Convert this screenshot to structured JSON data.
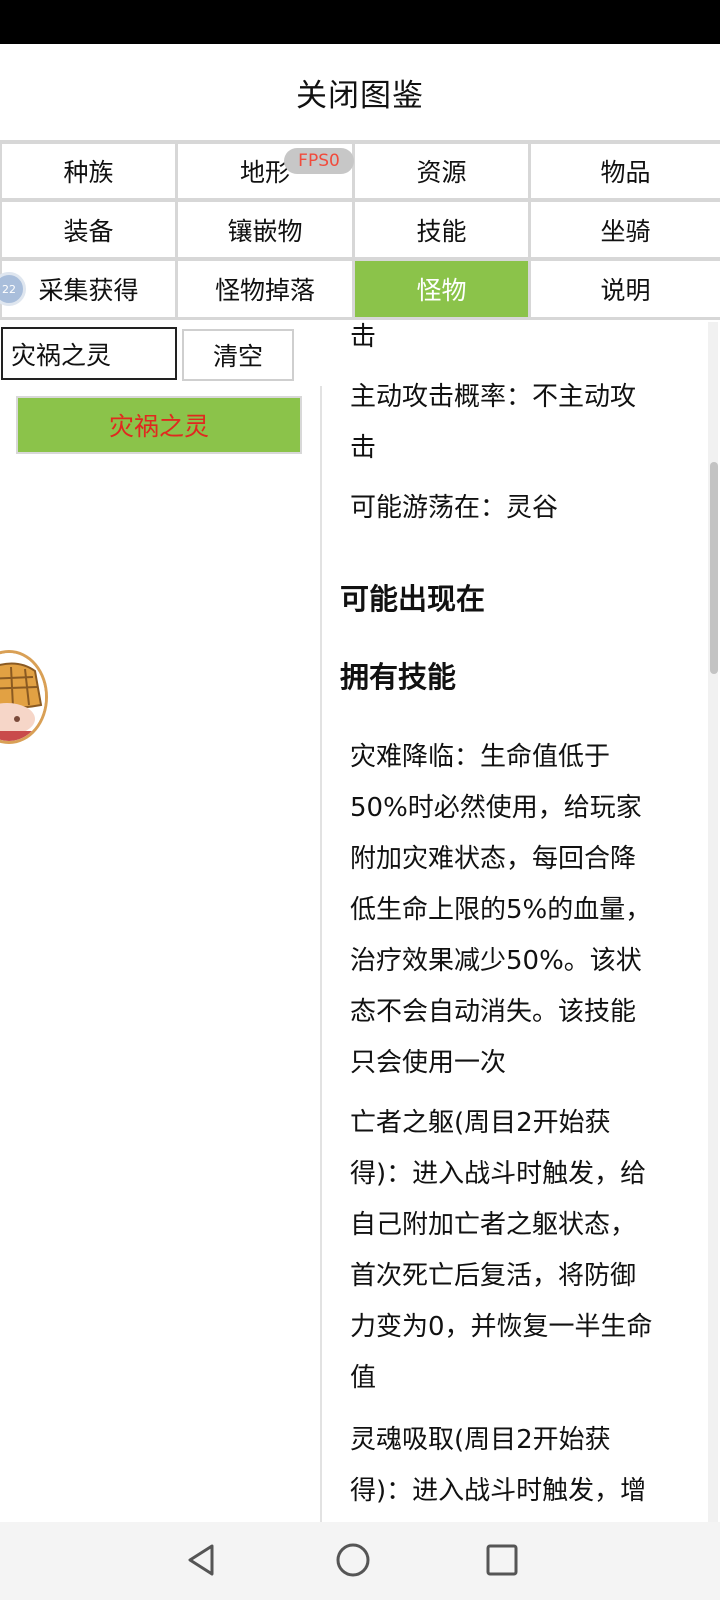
{
  "header": {
    "title": "关闭图鉴"
  },
  "fps_badge": "FPS0",
  "tiny_avatar_text": "22",
  "tabs": [
    {
      "label": "种族"
    },
    {
      "label": "地形"
    },
    {
      "label": "资源"
    },
    {
      "label": "物品"
    },
    {
      "label": "装备"
    },
    {
      "label": "镶嵌物"
    },
    {
      "label": "技能"
    },
    {
      "label": "坐骑"
    },
    {
      "label": "采集获得"
    },
    {
      "label": "怪物掉落"
    },
    {
      "label": "怪物",
      "active": true
    },
    {
      "label": "说明"
    }
  ],
  "search": {
    "value": "灾祸之灵"
  },
  "clear_label": "清空",
  "result_item": "灾祸之灵",
  "detail": {
    "top_fragment": "击",
    "active_attack_line1": "主动攻击概率：不主动攻",
    "active_attack_line2": "击",
    "wander": "可能游荡在：灵谷",
    "heading_appear": "可能出现在",
    "heading_skills": "拥有技能",
    "skill1": [
      "灾难降临：生命值低于",
      "50%时必然使用，给玩家",
      "附加灾难状态，每回合降",
      "低生命上限的5%的血量，",
      "治疗效果减少50%。该状",
      "态不会自动消失。该技能",
      "只会使用一次"
    ],
    "skill2": [
      "亡者之躯(周目2开始获",
      "得)：进入战斗时触发，给",
      "自己附加亡者之躯状态，",
      "首次死亡后复活，将防御",
      "力变为0，并恢复一半生命",
      "值"
    ],
    "skill3": [
      "灵魂吸取(周目2开始获",
      "得)：进入战斗时触发，增"
    ]
  },
  "colors": {
    "active_tab": "#8bc34a",
    "result_text": "#e0291f",
    "fps_text": "#f14b3c"
  },
  "nav": {
    "icons": [
      "back-icon",
      "home-icon",
      "recents-icon"
    ]
  }
}
